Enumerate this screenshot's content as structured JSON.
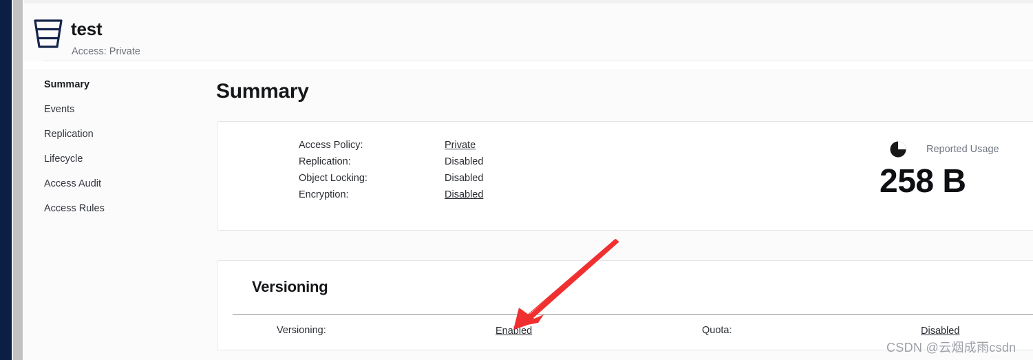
{
  "bucket": {
    "name": "test",
    "access_line": "Access: Private",
    "icon": "bucket-icon"
  },
  "sidebar": {
    "items": [
      {
        "label": "Summary",
        "active": true
      },
      {
        "label": "Events",
        "active": false
      },
      {
        "label": "Replication",
        "active": false
      },
      {
        "label": "Lifecycle",
        "active": false
      },
      {
        "label": "Access Audit",
        "active": false
      },
      {
        "label": "Access Rules",
        "active": false
      }
    ]
  },
  "main": {
    "section_title": "Summary",
    "summary_card": {
      "rows": [
        {
          "label": "Access Policy:",
          "value": "Private",
          "is_link": true
        },
        {
          "label": "Replication:",
          "value": "Disabled",
          "is_link": false
        },
        {
          "label": "Object Locking:",
          "value": "Disabled",
          "is_link": false
        },
        {
          "label": "Encryption:",
          "value": "Disabled",
          "is_link": true
        }
      ],
      "usage": {
        "icon": "pie-chart-icon",
        "caption": "Reported Usage",
        "value": "258 B"
      }
    },
    "versioning_card": {
      "title": "Versioning",
      "rows": [
        {
          "label": "Versioning:",
          "value": "Enabled"
        },
        {
          "label": "Quota:",
          "value": "Disabled"
        }
      ]
    }
  },
  "annotation": {
    "arrow_color": "#f03030",
    "points_at": "Enabled"
  },
  "watermark": {
    "text": "CSDN @云烟成雨csdn"
  },
  "colors": {
    "rail": "#0b1f44",
    "accent_navy": "#0b1f44",
    "panel_bg": "#fbfbfc",
    "card_bg": "#ffffff",
    "card_border": "#e4e5e8"
  }
}
